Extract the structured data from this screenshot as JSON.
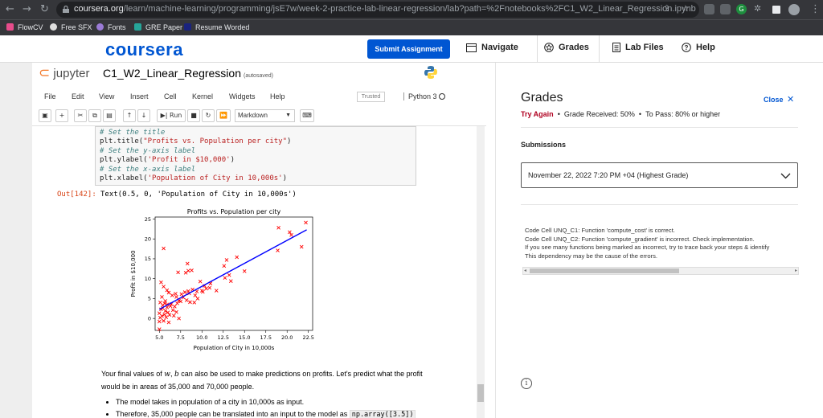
{
  "browser": {
    "url_host": "coursera.org",
    "url_path": "/learn/machine-learning/programming/jsE7w/week-2-practice-lab-linear-regression/lab?path=%2Fnotebooks%2FC1_W2_Linear_Regression.ipynb",
    "bookmarks": [
      "FlowCV",
      "Free SFX",
      "Fonts",
      "GRE Paper",
      "Resume Worded"
    ]
  },
  "coursera": {
    "logo": "coursera",
    "submit_label": "Submit Assignment",
    "nav": [
      "Navigate",
      "Grades",
      "Lab Files",
      "Help"
    ]
  },
  "notebook": {
    "logo": "jupyter",
    "title": "C1_W2_Linear_Regression",
    "autosaved": "(autosaved)",
    "menu": [
      "File",
      "Edit",
      "View",
      "Insert",
      "Cell",
      "Kernel",
      "Widgets",
      "Help"
    ],
    "trusted": "Trusted",
    "kernel": "Python 3",
    "run_label": "Run",
    "cell_type": "Markdown",
    "code": {
      "c1": "# Set the title",
      "l1a": "plt.title(",
      "l1s": "\"Profits vs. Population per city\"",
      "l1b": ")",
      "c2": "# Set the y-axis label",
      "l2a": "plt.ylabel(",
      "l2s": "'Profit in $10,000'",
      "l2b": ")",
      "c3": "# Set the x-axis label",
      "l3a": "plt.xlabel(",
      "l3s": "'Population of City in 10,000s'",
      "l3b": ")"
    },
    "out_prompt": "Out[142]:",
    "out_text": "Text(0.5, 0, 'Population of City in 10,000s')",
    "para": {
      "p1": "Your final values of ",
      "w": "w",
      "comma": ", ",
      "b": "b",
      "p2": " can also be used to make predictions on profits. Let's predict what the profit would be in areas of 35,000 and 70,000 people."
    },
    "bullets": {
      "b1": "The model takes in population of a city in 10,000s as input.",
      "b2": "Therefore, 35,000 people can be translated into an input to the model as ",
      "b2code": "np.array([3.5])"
    }
  },
  "chart_data": {
    "type": "scatter",
    "title": "Profits vs. Population per city",
    "xlabel": "Population of City in 10,000s",
    "ylabel": "Profit in $10,000",
    "xlim": [
      4.5,
      23.0
    ],
    "ylim": [
      -3,
      25.5
    ],
    "xticks": [
      "5.0",
      "7.5",
      "10.0",
      "12.5",
      "15.0",
      "17.5",
      "20.0",
      "22.5"
    ],
    "xtick_values": [
      5,
      7.5,
      10,
      12.5,
      15,
      17.5,
      20,
      22.5
    ],
    "yticks": [
      "0",
      "5",
      "10",
      "15",
      "20",
      "25"
    ],
    "ytick_values": [
      0,
      5,
      10,
      15,
      20,
      25
    ],
    "marker_color": "#ff0000",
    "line_color": "#0000ff",
    "points": [
      [
        22.2,
        24.1
      ],
      [
        19.0,
        22.8
      ],
      [
        20.3,
        21.7
      ],
      [
        20.5,
        21.0
      ],
      [
        18.9,
        17.1
      ],
      [
        21.7,
        18.0
      ],
      [
        5.5,
        17.6
      ],
      [
        8.3,
        13.8
      ],
      [
        8.4,
        12.0
      ],
      [
        8.8,
        12.1
      ],
      [
        7.2,
        11.6
      ],
      [
        8.1,
        11.5
      ],
      [
        12.9,
        14.7
      ],
      [
        12.6,
        13.2
      ],
      [
        14.1,
        15.4
      ],
      [
        15.0,
        11.9
      ],
      [
        13.2,
        10.9
      ],
      [
        12.7,
        10.2
      ],
      [
        13.4,
        9.4
      ],
      [
        10.3,
        8.2
      ],
      [
        10.9,
        7.7
      ],
      [
        11.7,
        7.0
      ],
      [
        10.1,
        6.7
      ],
      [
        10.0,
        7.0
      ],
      [
        9.4,
        6.8
      ],
      [
        9.5,
        5.0
      ],
      [
        9.1,
        4.0
      ],
      [
        8.5,
        6.3
      ],
      [
        8.0,
        6.6
      ],
      [
        7.8,
        5.3
      ],
      [
        7.3,
        4.5
      ],
      [
        7.0,
        5.4
      ],
      [
        6.5,
        5.8
      ],
      [
        6.1,
        6.5
      ],
      [
        5.9,
        7.1
      ],
      [
        5.5,
        8.0
      ],
      [
        5.2,
        9.1
      ],
      [
        5.7,
        4.4
      ],
      [
        5.4,
        3.3
      ],
      [
        5.9,
        3.5
      ],
      [
        6.3,
        3.1
      ],
      [
        6.8,
        3.0
      ],
      [
        7.1,
        3.8
      ],
      [
        7.5,
        4.3
      ],
      [
        8.2,
        4.6
      ],
      [
        8.6,
        4.1
      ],
      [
        9.2,
        5.8
      ],
      [
        6.6,
        2.1
      ],
      [
        6.0,
        1.5
      ],
      [
        5.6,
        1.0
      ],
      [
        5.3,
        0.6
      ],
      [
        5.1,
        0.2
      ],
      [
        5.0,
        -0.8
      ],
      [
        5.0,
        -2.7
      ],
      [
        5.5,
        -0.6
      ],
      [
        5.8,
        0.3
      ],
      [
        6.2,
        0.9
      ],
      [
        6.7,
        0.7
      ],
      [
        7.0,
        1.6
      ],
      [
        5.2,
        2.3
      ],
      [
        5.4,
        2.6
      ],
      [
        5.7,
        1.9
      ],
      [
        6.4,
        3.6
      ],
      [
        7.6,
        6.1
      ],
      [
        8.9,
        7.3
      ],
      [
        10.5,
        7.5
      ],
      [
        11.0,
        8.8
      ],
      [
        9.8,
        9.3
      ],
      [
        5.1,
        4.0
      ],
      [
        5.3,
        5.4
      ],
      [
        6.9,
        6.2
      ],
      [
        8.4,
        6.9
      ],
      [
        7.3,
        0.0
      ],
      [
        6.1,
        -1.0
      ],
      [
        5.9,
        2.8
      ],
      [
        5.0,
        1.3
      ],
      [
        5.6,
        3.8
      ]
    ],
    "fit_line": [
      [
        5.0,
        2.3
      ],
      [
        22.3,
        22.3
      ]
    ]
  },
  "grades": {
    "title": "Grades",
    "close": "Close",
    "try_again": "Try Again",
    "received": "Grade Received: 50%",
    "to_pass": "To Pass: 80% or higher",
    "submissions": "Submissions",
    "selected": "November 22, 2022 7:20 PM +04 (Highest Grade)",
    "feedback": [
      "Code Cell UNQ_C1: Function 'compute_cost' is correct.",
      "Code Cell UNQ_C2: Function 'compute_gradient' is incorrect. Check implementation.",
      "If you see many functions being marked as incorrect, try to trace back your steps & identify",
      "This dependency may be the cause of the errors."
    ]
  },
  "colors": {
    "brand": "#0056d2",
    "error": "#b00020",
    "chrome": "#35363a"
  }
}
